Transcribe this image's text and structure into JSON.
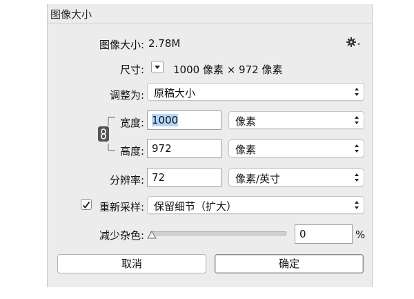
{
  "window": {
    "title": "图像大小"
  },
  "image_size": {
    "label": "图像大小:",
    "value": "2.78M"
  },
  "dimensions": {
    "label": "尺寸:",
    "value": "1000 像素  ×  972 像素"
  },
  "fit_to": {
    "label": "调整为:",
    "selected": "原稿大小"
  },
  "width": {
    "label": "宽度:",
    "value": "1000",
    "unit": "像素"
  },
  "height": {
    "label": "高度:",
    "value": "972",
    "unit": "像素"
  },
  "resolution": {
    "label": "分辨率:",
    "value": "72",
    "unit": "像素/英寸"
  },
  "resample": {
    "label": "重新采样:",
    "checked": true,
    "method": "保留细节（扩大）"
  },
  "noise": {
    "label": "减少杂色:",
    "value": "0",
    "unit": "%"
  },
  "buttons": {
    "cancel": "取消",
    "ok": "确定"
  }
}
